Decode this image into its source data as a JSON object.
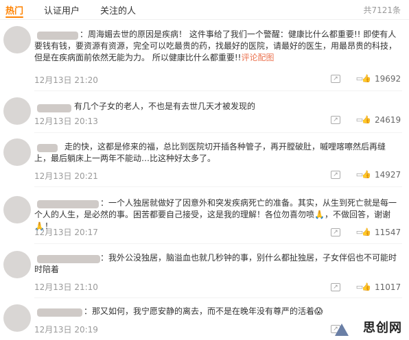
{
  "tabs": [
    {
      "label": "热门"
    },
    {
      "label": "认证用户"
    },
    {
      "label": "关注的人"
    }
  ],
  "total_count": "共7121条",
  "comments": [
    {
      "text": "：周海媚去世的原因是疾病！ 这件事给了我们一个警醒：健康比什么都重要!! 即使有人要钱有钱，要资源有资源，完全可以吃最贵的药，找最好的医院，请最好的医生，用最昂贵的科技，但是在疾病面前依然无能为力。 所以健康比什么都重要!!",
      "link": "评论配图",
      "time": "12月13日 21:20",
      "likes": "19692"
    },
    {
      "text": "有几个子女的老人，不也是有去世几天才被发现的",
      "time": "12月13日 20:13",
      "likes": "24619"
    },
    {
      "text": "走的快，这都是修来的福，总比到医院切开插各种管子，再开膛破肚，嘁哩喀嚓然后再缝上，最后躺床上一两年不能动…比这种好太多了。",
      "time": "12月13日 20:21",
      "likes": "14927"
    },
    {
      "text": "：一个人独居就做好了因意外和突发疾病死亡的准备。其实，从生到死亡就是每一个人的人生，是必然的事。困苦都要自己接受，这是我的理解！各位勿喜勿喷🙏，不做回答，谢谢🙏！",
      "time": "12月13日 20:17",
      "likes": "11547"
    },
    {
      "text": "：我外公没独居，脑溢血也就几秒钟的事，别什么都扯独居，子女伴侣也不可能时时陪着",
      "time": "12月13日 21:10",
      "likes": "11017"
    },
    {
      "text": "：那又如何，我宁愿安静的离去，而不是在晚年没有尊严的活着😱",
      "time": "12月13日 20:19",
      "likes": ""
    }
  ],
  "watermark": "思创网",
  "icons": {
    "share": "share-icon",
    "comment": "comment-icon",
    "like": "like-icon"
  },
  "colors": {
    "accent": "#ff8200",
    "link": "#eb7350",
    "meta": "#999999"
  }
}
